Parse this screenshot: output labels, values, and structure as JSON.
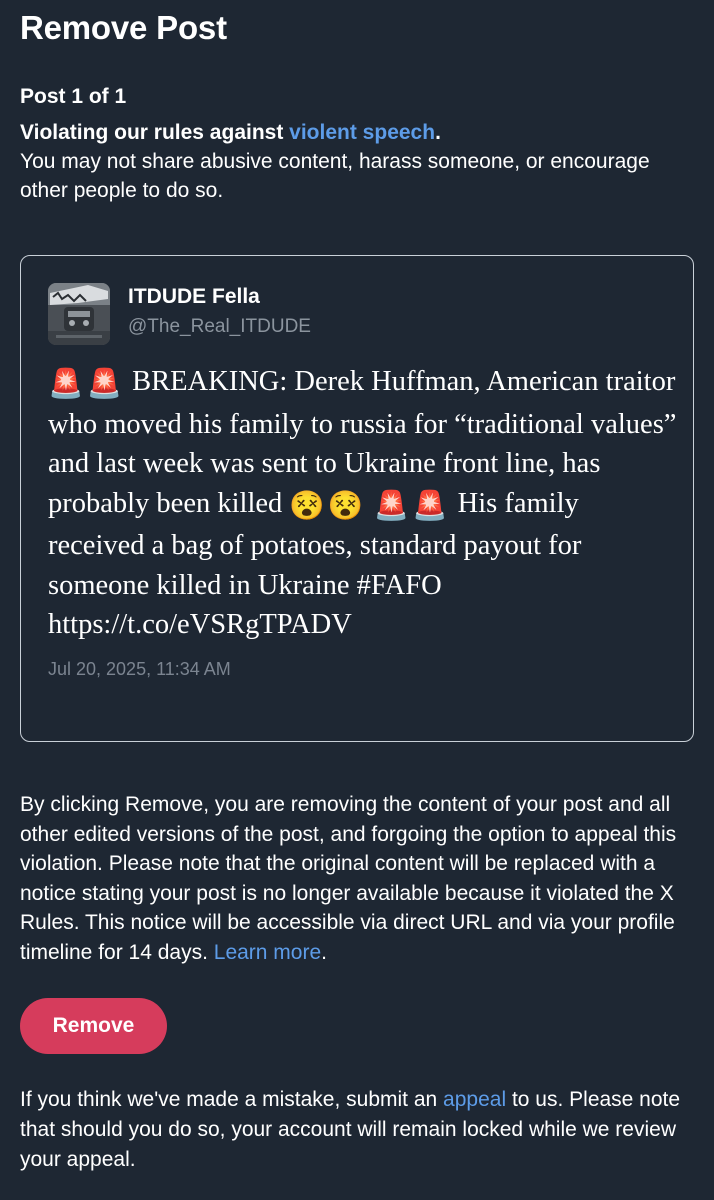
{
  "header": {
    "title": "Remove Post"
  },
  "violation": {
    "post_count": "Post 1 of 1",
    "headline_prefix": "Violating our rules against ",
    "rule_link": "violent speech",
    "headline_suffix": ".",
    "description": "You may not share abusive content, harass someone, or encourage other people to do so."
  },
  "tweet": {
    "author_name": "ITDUDE Fella",
    "author_handle": "@The_Real_ITDUDE",
    "emoji_siren": "🚨",
    "emoji_dizzy": "😵",
    "text_part1": "BREAKING: Derek Huffman, American traitor who moved his family to russia for “traditional values” and last week was sent to Ukraine front line, has probably been killed",
    "text_part2": "His family received a bag of potatoes, standard payout for someone killed in Ukraine #FAFO https://t.co/eVSRgTPADV",
    "timestamp": "Jul 20, 2025, 11:34 AM"
  },
  "notice": {
    "text": "By clicking Remove, you are removing the content of your post and all other edited versions of the post, and forgoing the option to appeal this violation. Please note that the original content will be replaced with a notice stating your post is no longer available because it violated the X Rules. This notice will be accessible via direct URL and via your profile timeline for 14 days. ",
    "learn_more": "Learn more",
    "suffix": "."
  },
  "actions": {
    "remove_label": "Remove"
  },
  "appeal": {
    "prefix": "If you think we've made a mistake, submit an ",
    "link": "appeal",
    "suffix": " to us. Please note that should you do so, your account will remain locked while we review your appeal."
  },
  "colors": {
    "background": "#1e2733",
    "link": "#5d9ce8",
    "remove_button": "#d63c5c",
    "card_border": "#c9d0d8",
    "muted_text": "#8b949e"
  }
}
